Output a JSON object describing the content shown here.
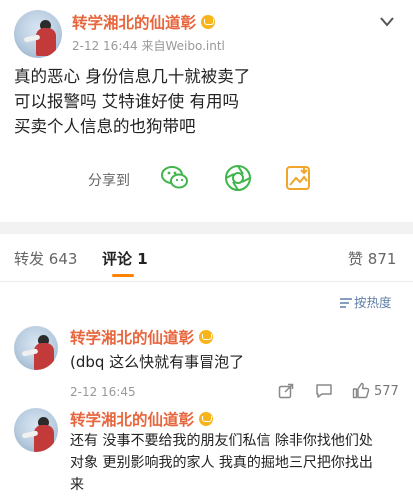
{
  "post": {
    "author": "转学湘北的仙道彰",
    "meta": "2-12 16:44  来自Weibo.intl",
    "lines": [
      "真的恶心 身份信息几十就被卖了",
      "可以报警吗 艾特谁好使 有用吗",
      "买卖个人信息的也狗带吧"
    ],
    "share_label": "分享到",
    "menu_icon": "chevron-down-icon"
  },
  "tabs": {
    "repost_label": "转发",
    "repost_count": "643",
    "comment_label": "评论",
    "comment_count": "1",
    "like_label": "赞",
    "like_count": "871"
  },
  "sort": {
    "label": "按热度"
  },
  "comments": [
    {
      "author": "转学湘北的仙道彰",
      "text_lines": [
        "(dbq 这么快就有事冒泡了"
      ],
      "time": "2-12 16:45",
      "likes": "577"
    },
    {
      "author": "转学湘北的仙道彰",
      "text_lines": [
        "还有 没事不要给我的朋友们私信 除非你找他们处",
        "对象 更别影响我的家人 我真的掘地三尺把你找出",
        "来"
      ]
    }
  ],
  "colors": {
    "username": "#e8663d",
    "accent": "#ff8200",
    "link": "#5f7fa8",
    "wechat": "#3fb54a",
    "moments": "#3fb54a",
    "album": "#f0a52b"
  }
}
